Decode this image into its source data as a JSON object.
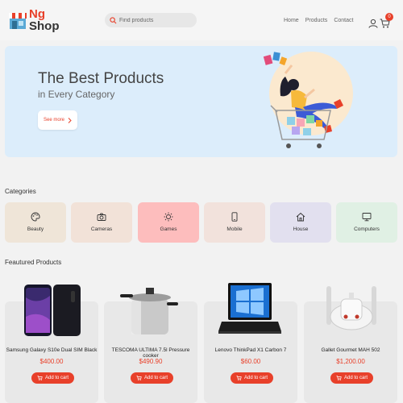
{
  "brand": {
    "line1": "Ng",
    "line2": "Shop"
  },
  "search": {
    "placeholder": "Find products"
  },
  "nav": {
    "items": [
      "Home",
      "Products",
      "Contact"
    ]
  },
  "cart": {
    "count": "0"
  },
  "hero": {
    "title": "The Best Products",
    "subtitle": "in Every Category",
    "cta": "See more"
  },
  "categories": {
    "title": "Categories",
    "items": [
      {
        "label": "Beauty",
        "icon": "palette-icon",
        "color": "#efe5d8"
      },
      {
        "label": "Cameras",
        "icon": "camera-icon",
        "color": "#f2e2d8"
      },
      {
        "label": "Games",
        "icon": "sun-icon",
        "color": "#fdbdbd"
      },
      {
        "label": "Mobile",
        "icon": "mobile-icon",
        "color": "#f2e2dc"
      },
      {
        "label": "House",
        "icon": "house-icon",
        "color": "#e2e0ef"
      },
      {
        "label": "Computers",
        "icon": "monitor-icon",
        "color": "#e0f0e4"
      }
    ]
  },
  "products": {
    "title": "Feautured Products",
    "button_label": "Add to cart",
    "items": [
      {
        "name": "Samsung Galaxy S10e Dual SIM Black",
        "price": "$400.00"
      },
      {
        "name": "TESCOMA ULTIMA 7.5l Pressure cooker",
        "price": "$490.90"
      },
      {
        "name": "Lenovo ThinkPad X1 Carbon 7",
        "price": "$60.00"
      },
      {
        "name": "Gallet Gourmet MAH 502",
        "price": "$1,200.00"
      }
    ]
  },
  "colors": {
    "accent": "#e8402a",
    "hero_bg": "#dcedfb"
  }
}
